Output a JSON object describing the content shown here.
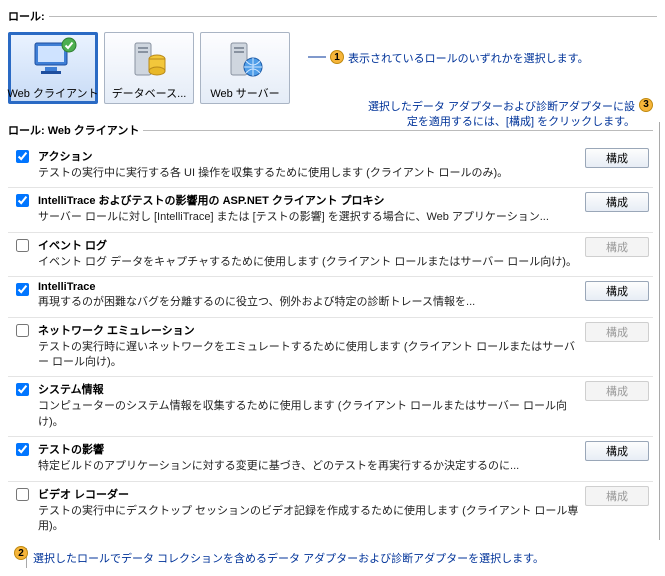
{
  "section_roles_label": "ロール:",
  "roles": [
    {
      "label": "Web クライアント"
    },
    {
      "label": "データベース..."
    },
    {
      "label": "Web サーバー"
    }
  ],
  "callouts": {
    "c1": {
      "num": "1",
      "text": "表示されているロールのいずれかを選択します。"
    },
    "c2": {
      "num": "2",
      "text": "選択したロールでデータ コレクションを含めるデータ アダプターおよび診断アダプターを選択します。"
    },
    "c3": {
      "num": "3",
      "text": "選択したデータ アダプターおよび診断アダプターに設定を適用するには、[構成] をクリックします。"
    }
  },
  "section_adapters_label": "ロール: Web クライアント",
  "configure_label": "構成",
  "adapters": [
    {
      "title": "アクション",
      "desc": "テストの実行中に実行する各 UI 操作を収集するために使用します (クライアント ロールのみ)。",
      "checked": true,
      "enabled": true
    },
    {
      "title": "IntelliTrace およびテストの影響用の ASP.NET クライアント プロキシ",
      "desc": "サーバー ロールに対し [IntelliTrace] または [テストの影響] を選択する場合に、Web アプリケーション...",
      "checked": true,
      "enabled": true
    },
    {
      "title": "イベント ログ",
      "desc": "イベント ログ データをキャプチャするために使用します (クライアント ロールまたはサーバー ロール向け)。",
      "checked": false,
      "enabled": false
    },
    {
      "title": "IntelliTrace",
      "desc": "再現するのが困難なバグを分離するのに役立つ、例外および特定の診断トレース情報を...",
      "checked": true,
      "enabled": true
    },
    {
      "title": "ネットワーク エミュレーション",
      "desc": "テストの実行時に遅いネットワークをエミュレートするために使用します (クライアント ロールまたはサーバー ロール向け)。",
      "checked": false,
      "enabled": false
    },
    {
      "title": "システム情報",
      "desc": "コンピューターのシステム情報を収集するために使用します (クライアント ロールまたはサーバー ロール向け)。",
      "checked": true,
      "enabled": false
    },
    {
      "title": "テストの影響",
      "desc": "特定ビルドのアプリケーションに対する変更に基づき、どのテストを再実行するか決定するのに...",
      "checked": true,
      "enabled": true
    },
    {
      "title": "ビデオ レコーダー",
      "desc": "テストの実行中にデスクトップ セッションのビデオ記録を作成するために使用します (クライアント ロール専用)。",
      "checked": false,
      "enabled": false
    }
  ]
}
